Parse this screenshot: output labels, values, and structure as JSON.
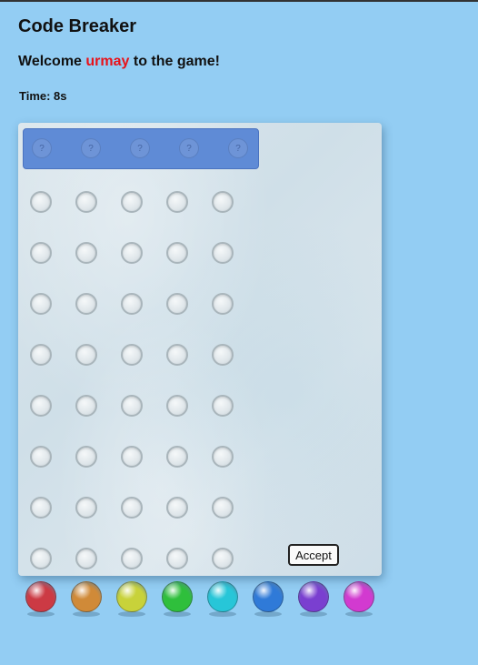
{
  "header": {
    "title": "Code Breaker",
    "welcome_prefix": "Welcome ",
    "username": "urmay",
    "welcome_suffix": " to the game!",
    "time_label": "Time: 8s"
  },
  "secret": {
    "slots": [
      "?",
      "?",
      "?",
      "?",
      "?"
    ]
  },
  "board": {
    "rows": 8,
    "columns": 5,
    "accept_label": "Accept"
  },
  "palette": [
    {
      "name": "red",
      "color": "#cc3a44"
    },
    {
      "name": "orange",
      "color": "#d08a38"
    },
    {
      "name": "yellow",
      "color": "#c8d23a"
    },
    {
      "name": "green",
      "color": "#2fbf3c"
    },
    {
      "name": "cyan",
      "color": "#27c6d8"
    },
    {
      "name": "blue",
      "color": "#2f7ad8"
    },
    {
      "name": "purple",
      "color": "#7a3fd0"
    },
    {
      "name": "magenta",
      "color": "#d23ad0"
    }
  ]
}
